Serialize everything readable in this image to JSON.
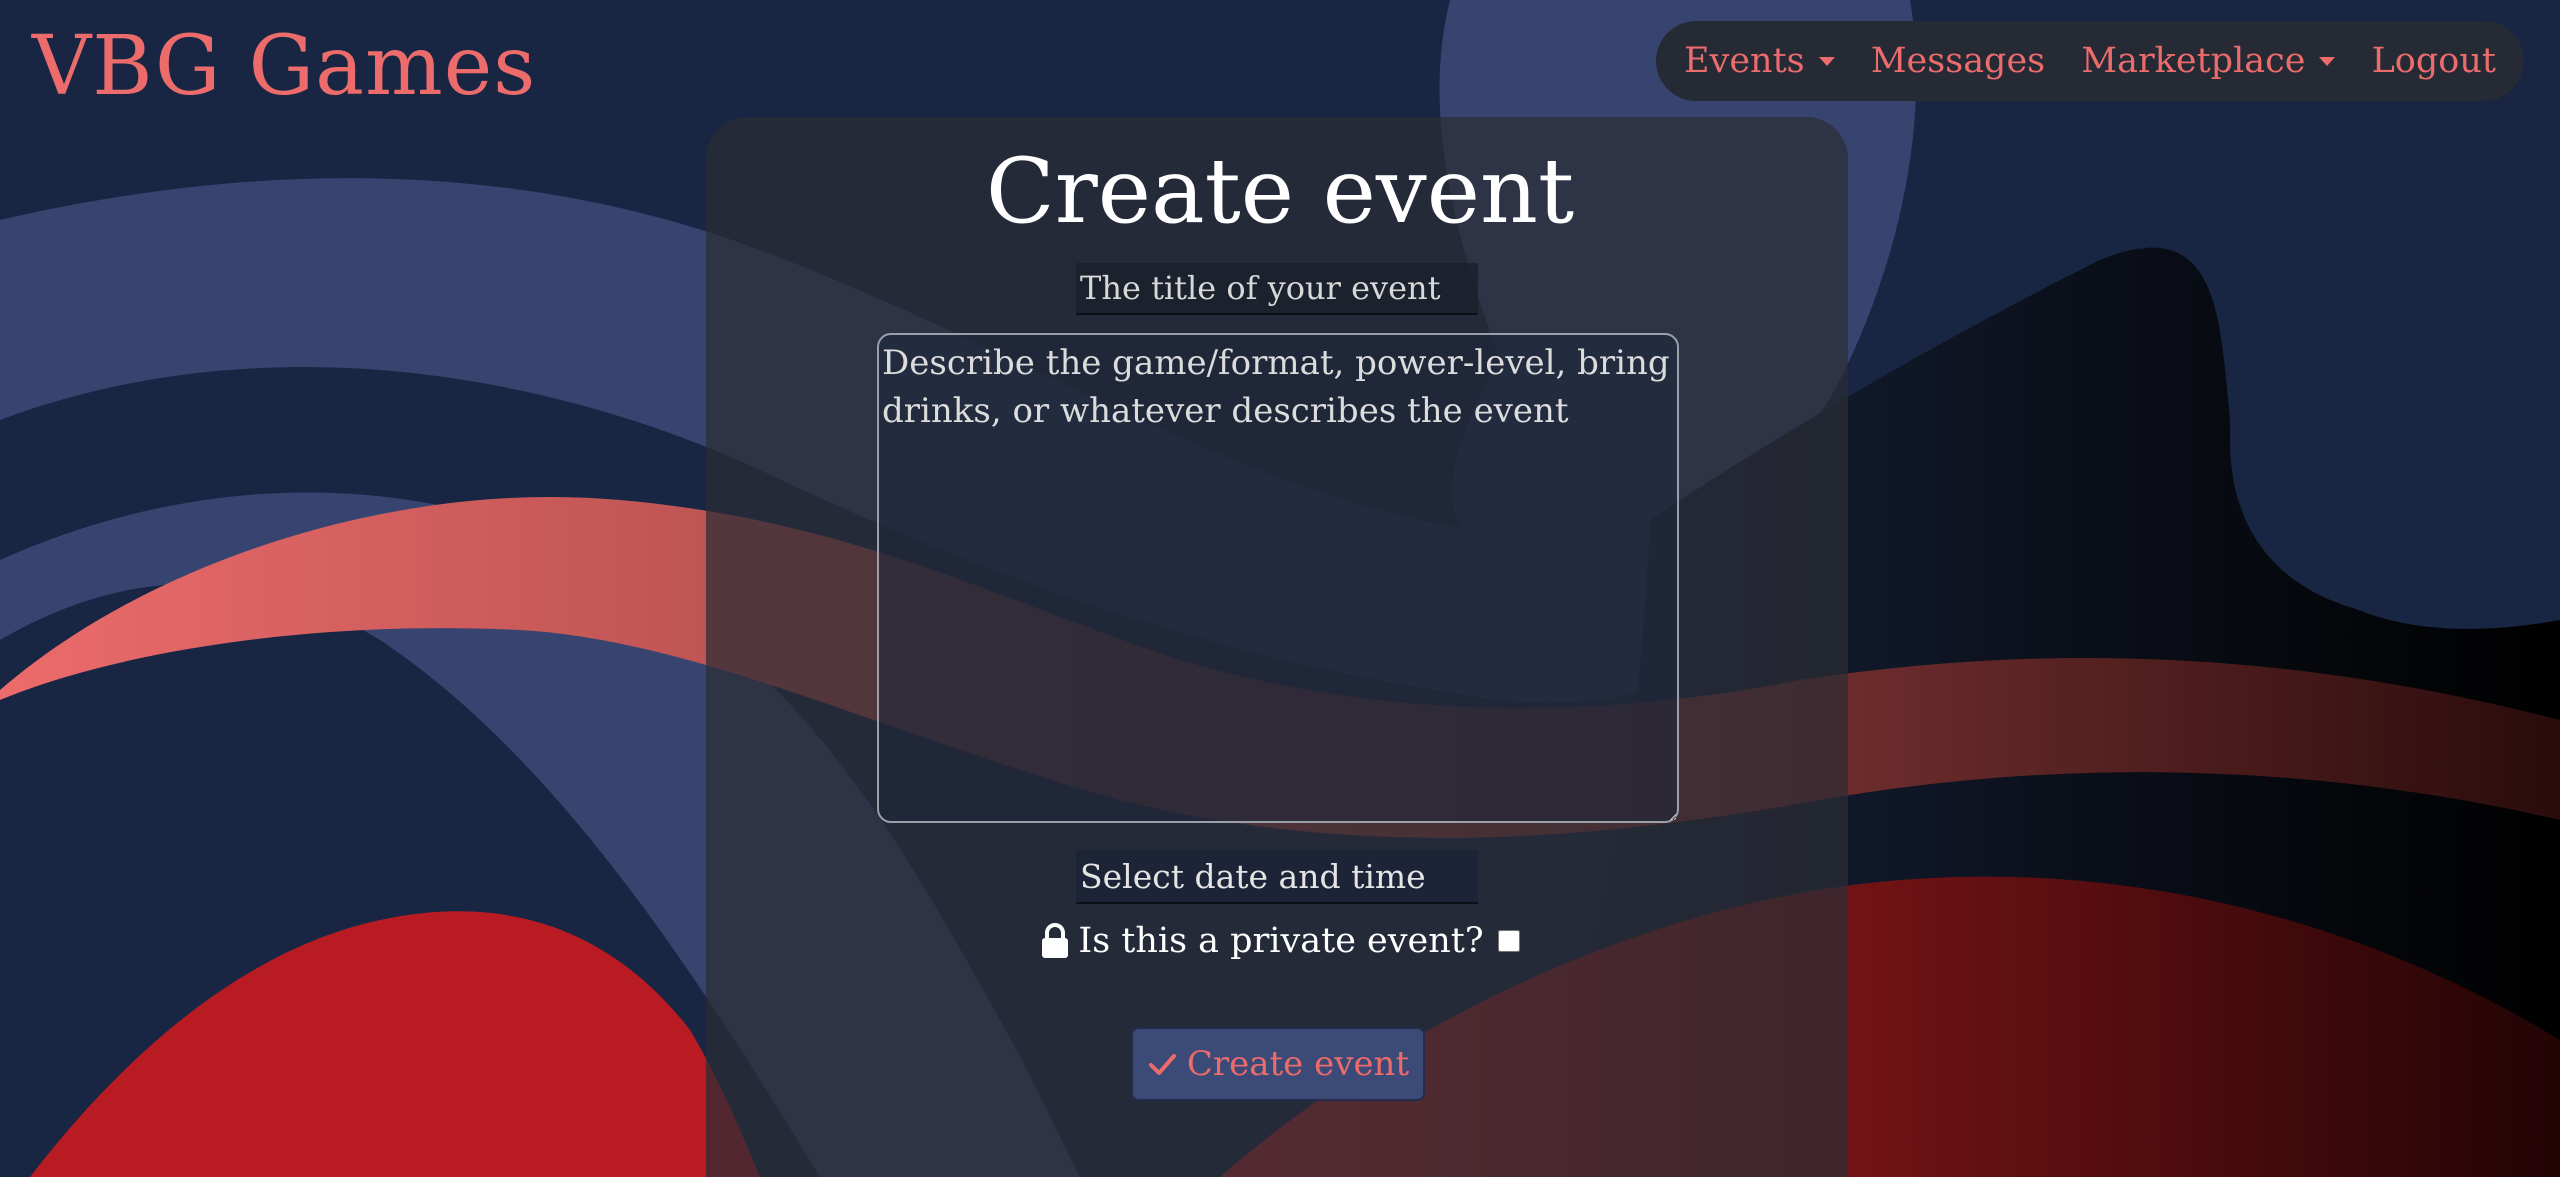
{
  "brand": "VBG Games",
  "nav": {
    "events": "Events",
    "messages": "Messages",
    "marketplace": "Marketplace",
    "logout": "Logout"
  },
  "form": {
    "heading": "Create event",
    "title_placeholder": "The title of your event",
    "description_placeholder": "Describe the game/format, power-level, bring drinks, or whatever describes the event",
    "date_placeholder": "Select date and time",
    "private_label": "Is this a private event?",
    "private_checked": false,
    "submit_label": "Create event"
  },
  "icons": {
    "events_dropdown": "chevron-down-icon",
    "marketplace_dropdown": "chevron-down-icon",
    "private": "lock-icon",
    "submit": "check-icon"
  },
  "colors": {
    "accent": "#ec6b6b",
    "background": "#182643",
    "button": "#3c4a78"
  }
}
